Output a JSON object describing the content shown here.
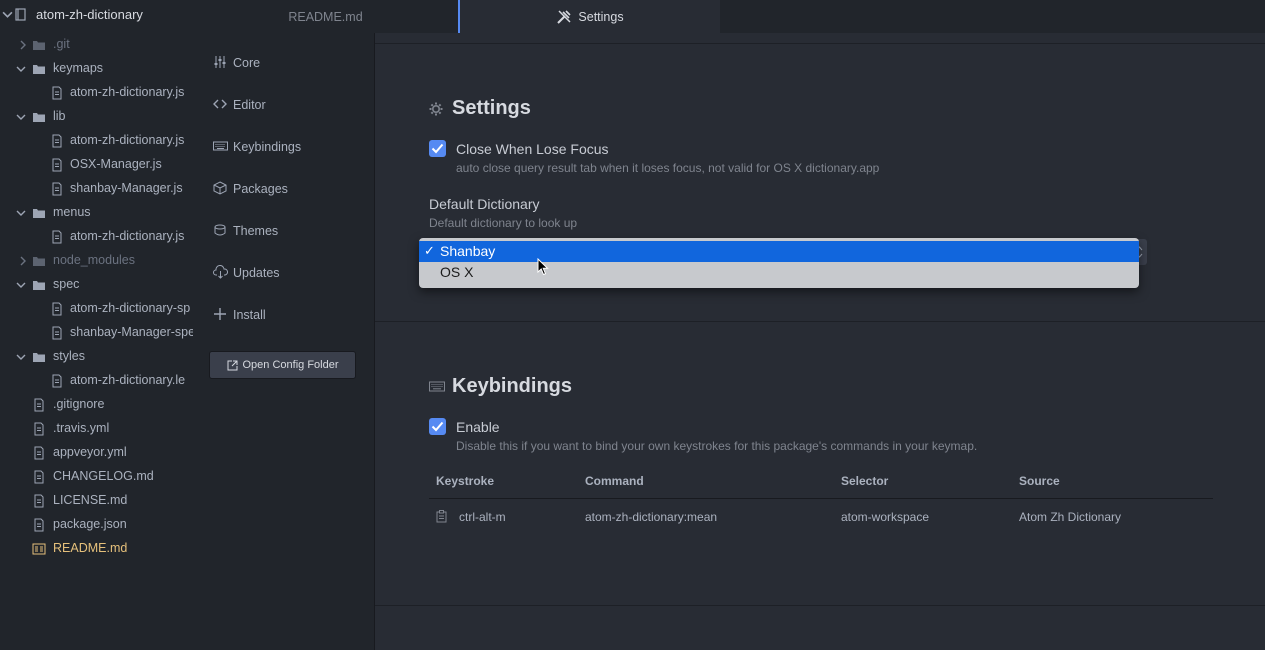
{
  "tree": {
    "project": "atom-zh-dictionary",
    "items": [
      {
        "label": ".git",
        "type": "folder",
        "open": false,
        "dim": true
      },
      {
        "label": "keymaps",
        "type": "folder",
        "open": true
      },
      {
        "label": "atom-zh-dictionary.js",
        "type": "file"
      },
      {
        "label": "lib",
        "type": "folder",
        "open": true
      },
      {
        "label": "atom-zh-dictionary.js",
        "type": "file"
      },
      {
        "label": "OSX-Manager.js",
        "type": "file"
      },
      {
        "label": "shanbay-Manager.js",
        "type": "file"
      },
      {
        "label": "menus",
        "type": "folder",
        "open": true
      },
      {
        "label": "atom-zh-dictionary.js",
        "type": "file"
      },
      {
        "label": "node_modules",
        "type": "folder",
        "open": false,
        "dim": true
      },
      {
        "label": "spec",
        "type": "folder",
        "open": true
      },
      {
        "label": "atom-zh-dictionary-sp",
        "type": "file"
      },
      {
        "label": "shanbay-Manager-spe",
        "type": "file"
      },
      {
        "label": "styles",
        "type": "folder",
        "open": true
      },
      {
        "label": "atom-zh-dictionary.le",
        "type": "file"
      },
      {
        "label": ".gitignore",
        "type": "file"
      },
      {
        "label": ".travis.yml",
        "type": "file"
      },
      {
        "label": "appveyor.yml",
        "type": "file"
      },
      {
        "label": "CHANGELOG.md",
        "type": "file"
      },
      {
        "label": "LICENSE.md",
        "type": "file"
      },
      {
        "label": "package.json",
        "type": "file"
      },
      {
        "label": "README.md",
        "type": "file-md",
        "selected": true
      }
    ]
  },
  "tabs": {
    "readme": "README.md",
    "settings": "Settings"
  },
  "settings_nav": {
    "items": [
      "Core",
      "Editor",
      "Keybindings",
      "Packages",
      "Themes",
      "Updates",
      "Install"
    ],
    "open_config": "Open Config Folder"
  },
  "settings_section": {
    "title": "Settings",
    "close_focus": {
      "title": "Close When Lose Focus",
      "desc": "auto close query result tab when it loses focus, not valid for OS X dictionary.app",
      "checked": true
    },
    "default_dictionary": {
      "title": "Default Dictionary",
      "desc": "Default dictionary to look up",
      "options": [
        "Shanbay",
        "OS X"
      ],
      "selected": "Shanbay",
      "checkmark": "✓"
    }
  },
  "keybindings_section": {
    "title": "Keybindings",
    "enable": {
      "title": "Enable",
      "desc": "Disable this if you want to bind your own keystrokes for this package's commands in your keymap.",
      "checked": true
    },
    "headers": [
      "Keystroke",
      "Command",
      "Selector",
      "Source"
    ],
    "rows": [
      {
        "keystroke": "ctrl-alt-m",
        "command": "atom-zh-dictionary:mean",
        "selector": "atom-workspace",
        "source": "Atom Zh Dictionary"
      }
    ]
  },
  "colors": {
    "accent": "#568af2",
    "selected_file": "#e5c07b",
    "dropdown_highlight": "#1166dd"
  }
}
